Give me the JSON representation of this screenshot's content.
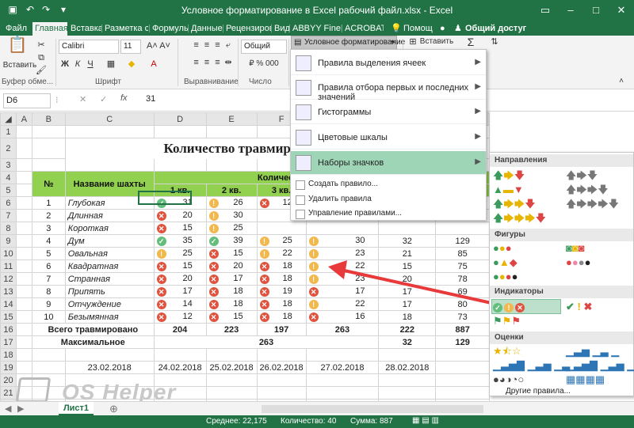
{
  "window": {
    "title": "Условное форматирование в Excel рабочий файл.xlsx - Excel"
  },
  "tabs": [
    "Файл",
    "Главная",
    "Вставка",
    "Разметка стран",
    "Формулы",
    "Данные",
    "Рецензировани",
    "Вид",
    "ABBYY FineReac",
    "ACROBAT"
  ],
  "tell_me": "Помощ",
  "share": "Общий доступ",
  "ribbon": {
    "paste": "Вставить",
    "clipboard": "Буфер обме...",
    "font": "Calibri",
    "font_size": "11",
    "font_group": "Шрифт",
    "align_group": "Выравнивание",
    "number_format": "Общий",
    "number_group": "Число",
    "cond_format": "Условное форматирование",
    "insert": "Вставить"
  },
  "formula_bar": {
    "cell": "D6",
    "value": "31"
  },
  "columns": [
    "A",
    "B",
    "C",
    "D",
    "E",
    "F",
    "G",
    "H",
    "I",
    "J"
  ],
  "sheet": {
    "title": "Количество травмированны",
    "h_num": "№",
    "h_name": "Название шахты",
    "h_group": "Количество травмированных",
    "q1": "1 кв.",
    "q2": "2 кв.",
    "q3": "3 кв.",
    "rows": [
      {
        "n": "1",
        "name": "Глубокая",
        "d": "31",
        "dc": "g",
        "e": "26",
        "ec": "y",
        "f": "12",
        "fc": "r",
        "g": "",
        "gc": "",
        "h": "",
        "i": ""
      },
      {
        "n": "2",
        "name": "Длинная",
        "d": "20",
        "dc": "r",
        "e": "30",
        "ec": "y",
        "f": "",
        "fc": "",
        "g": "",
        "gc": "",
        "h": "",
        "i": ""
      },
      {
        "n": "3",
        "name": "Короткая",
        "d": "15",
        "dc": "r",
        "e": "25",
        "ec": "y",
        "f": "",
        "fc": "",
        "g": "",
        "gc": "",
        "h": "",
        "i": ""
      },
      {
        "n": "4",
        "name": "Дум",
        "d": "35",
        "dc": "g",
        "e": "39",
        "ec": "g",
        "f": "25",
        "fc": "y",
        "g": "30",
        "gc": "y",
        "h": "32",
        "i": "129"
      },
      {
        "n": "5",
        "name": "Овальная",
        "d": "25",
        "dc": "y",
        "e": "15",
        "ec": "r",
        "f": "22",
        "fc": "y",
        "g": "23",
        "gc": "y",
        "h": "21",
        "i": "85"
      },
      {
        "n": "6",
        "name": "Квадратная",
        "d": "15",
        "dc": "r",
        "e": "20",
        "ec": "r",
        "f": "18",
        "fc": "r",
        "g": "22",
        "gc": "y",
        "h": "15",
        "i": "75"
      },
      {
        "n": "7",
        "name": "Странная",
        "d": "20",
        "dc": "r",
        "e": "17",
        "ec": "r",
        "f": "18",
        "fc": "r",
        "g": "23",
        "gc": "y",
        "h": "20",
        "i": "78"
      },
      {
        "n": "8",
        "name": "Припять",
        "d": "17",
        "dc": "r",
        "e": "18",
        "ec": "r",
        "f": "19",
        "fc": "r",
        "g": "17",
        "gc": "r",
        "h": "17",
        "i": "69"
      },
      {
        "n": "9",
        "name": "Отчуждение",
        "d": "14",
        "dc": "r",
        "e": "18",
        "ec": "r",
        "f": "18",
        "fc": "r",
        "g": "22",
        "gc": "y",
        "h": "17",
        "i": "80"
      },
      {
        "n": "10",
        "name": "Безымянная",
        "d": "12",
        "dc": "r",
        "e": "15",
        "ec": "r",
        "f": "18",
        "fc": "r",
        "g": "16",
        "gc": "r",
        "h": "18",
        "i": "73"
      }
    ],
    "total_label": "Всего травмировано",
    "total_d": "204",
    "total_e": "223",
    "total_f": "197",
    "total_g": "263",
    "total_h": "222",
    "total_i": "887",
    "max_label": "Максимальное",
    "max_val": "263",
    "max_h": "32",
    "max_i": "129",
    "dates": [
      "23.02.2018",
      "24.02.2018",
      "25.02.2018",
      "26.02.2018",
      "27.02.2018",
      "28.02.2018"
    ]
  },
  "menu": {
    "items": [
      "Правила выделения ячеек",
      "Правила отбора первых и последних значений",
      "Гистограммы",
      "Цветовые шкалы",
      "Наборы значков"
    ],
    "small": [
      "Создать правило...",
      "Удалить правила",
      "Управление правилами..."
    ]
  },
  "iconsets": {
    "s1": "Направления",
    "s2": "Фигуры",
    "s3": "Индикаторы",
    "s4": "Оценки",
    "more": "Другие правила..."
  },
  "sheet_tab": "Лист1",
  "status": {
    "avg": "Среднее: 22,175",
    "count": "Количество: 40",
    "sum": "Сумма: 887"
  },
  "watermark": "OS Helper"
}
